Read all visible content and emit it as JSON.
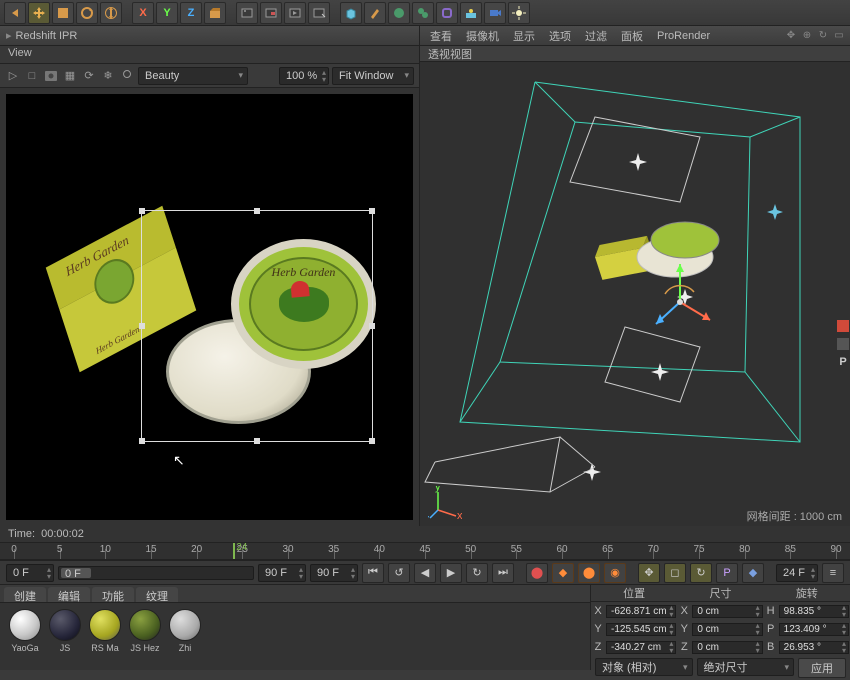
{
  "top_toolbar": {
    "axis_x": "X",
    "axis_y": "Y",
    "axis_z": "Z"
  },
  "ipr": {
    "title": "Redshift IPR",
    "view_menu": "View",
    "pass": "Beauty",
    "zoom": "100 %",
    "fit": "Fit Window"
  },
  "render_image": {
    "box_brand_top": "Herb Garden",
    "box_brand_bottom": "Herb Garden",
    "lid_brand": "Herb Garden"
  },
  "viewport": {
    "menus": [
      "查看",
      "摄像机",
      "显示",
      "选项",
      "过滤",
      "面板",
      "ProRender"
    ],
    "tab": "透视视图",
    "grid_info": "网格间距 : 1000 cm"
  },
  "time": {
    "label": "Time:",
    "value": "00:00:02"
  },
  "ruler": {
    "ticks": [
      0,
      5,
      10,
      15,
      20,
      25,
      30,
      35,
      40,
      45,
      50,
      55,
      60,
      65,
      70,
      75,
      80,
      85,
      90
    ],
    "playhead": 24
  },
  "transport": {
    "start": "0 F",
    "cur": "0 F",
    "end": "90 F",
    "end2": "90 F",
    "fps": "24 F"
  },
  "tabs": [
    "创建",
    "编辑",
    "功能",
    "纹理"
  ],
  "materials": [
    {
      "name": "YaoGa",
      "bg": "radial-gradient(circle at 35% 30%,#fff,#c9c9c9 55%,#888)"
    },
    {
      "name": "JS",
      "bg": "radial-gradient(circle at 35% 30%,#5a5a6a,#26263a 60%,#0a0a14)"
    },
    {
      "name": "RS Ma",
      "bg": "radial-gradient(circle at 35% 30%,#e0e060,#a5a520 60%,#555)"
    },
    {
      "name": "JS Hez",
      "bg": "radial-gradient(circle at 35% 30%,#8aa040,#4a6020 60%,#222)"
    },
    {
      "name": "Zhi",
      "bg": "radial-gradient(circle at 35% 30%,#ddd,#aaa 60%,#666)"
    }
  ],
  "coord": {
    "headers": [
      "位置",
      "尺寸",
      "旋转"
    ],
    "rows": [
      {
        "axis": "X",
        "pos": "-626.871 cm",
        "size": "0 cm",
        "rot": "98.835 °"
      },
      {
        "axis": "Y",
        "pos": "-125.545 cm",
        "size": "0 cm",
        "rot": "123.409 °"
      },
      {
        "axis": "Z",
        "pos": "-340.27 cm",
        "size": "0 cm",
        "rot": "26.953 °"
      }
    ],
    "mode1": "对象 (相对)",
    "mode2": "绝对尺寸",
    "apply": "应用",
    "rot_labels": [
      "H",
      "P",
      "B"
    ],
    "size_labels": [
      "X",
      "Y",
      "Z"
    ]
  }
}
